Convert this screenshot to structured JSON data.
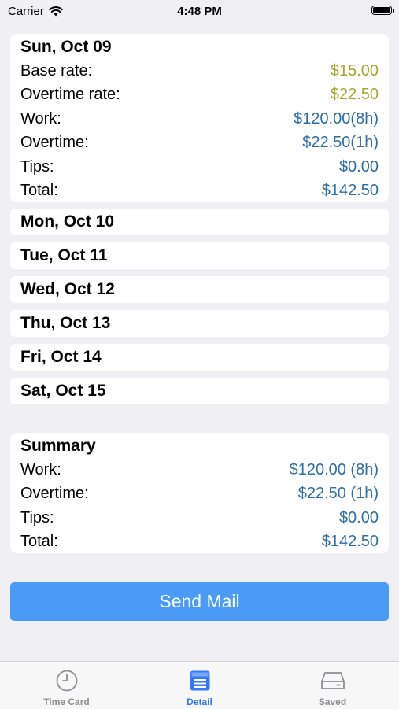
{
  "status": {
    "carrier": "Carrier",
    "time": "4:48 PM"
  },
  "day_detail": {
    "title": "Sun, Oct 09",
    "rows": [
      {
        "label": "Base rate:",
        "value": "$15.00"
      },
      {
        "label": "Overtime rate:",
        "value": "$22.50"
      },
      {
        "label": "Work:",
        "value": "$120.00(8h)"
      },
      {
        "label": "Overtime:",
        "value": "$22.50(1h)"
      },
      {
        "label": "Tips:",
        "value": "$0.00"
      },
      {
        "label": "Total:",
        "value": "$142.50"
      }
    ]
  },
  "days": [
    "Mon, Oct 10",
    "Tue, Oct 11",
    "Wed, Oct 12",
    "Thu, Oct 13",
    "Fri, Oct 14",
    "Sat, Oct 15"
  ],
  "summary": {
    "title": "Summary",
    "rows": [
      {
        "label": "Work:",
        "value": "$120.00 (8h)"
      },
      {
        "label": "Overtime:",
        "value": "$22.50 (1h)"
      },
      {
        "label": "Tips:",
        "value": "$0.00"
      },
      {
        "label": "Total:",
        "value": "$142.50"
      }
    ]
  },
  "send_button": "Send Mail",
  "tabs": [
    {
      "label": "Time Card",
      "icon": "clock-icon"
    },
    {
      "label": "Detail",
      "icon": "list-icon"
    },
    {
      "label": "Saved",
      "icon": "tray-icon"
    }
  ],
  "colors": {
    "rate": "#a7a632",
    "value": "#2d6ea5",
    "accent": "#3478f6",
    "button": "#4b9af5"
  }
}
